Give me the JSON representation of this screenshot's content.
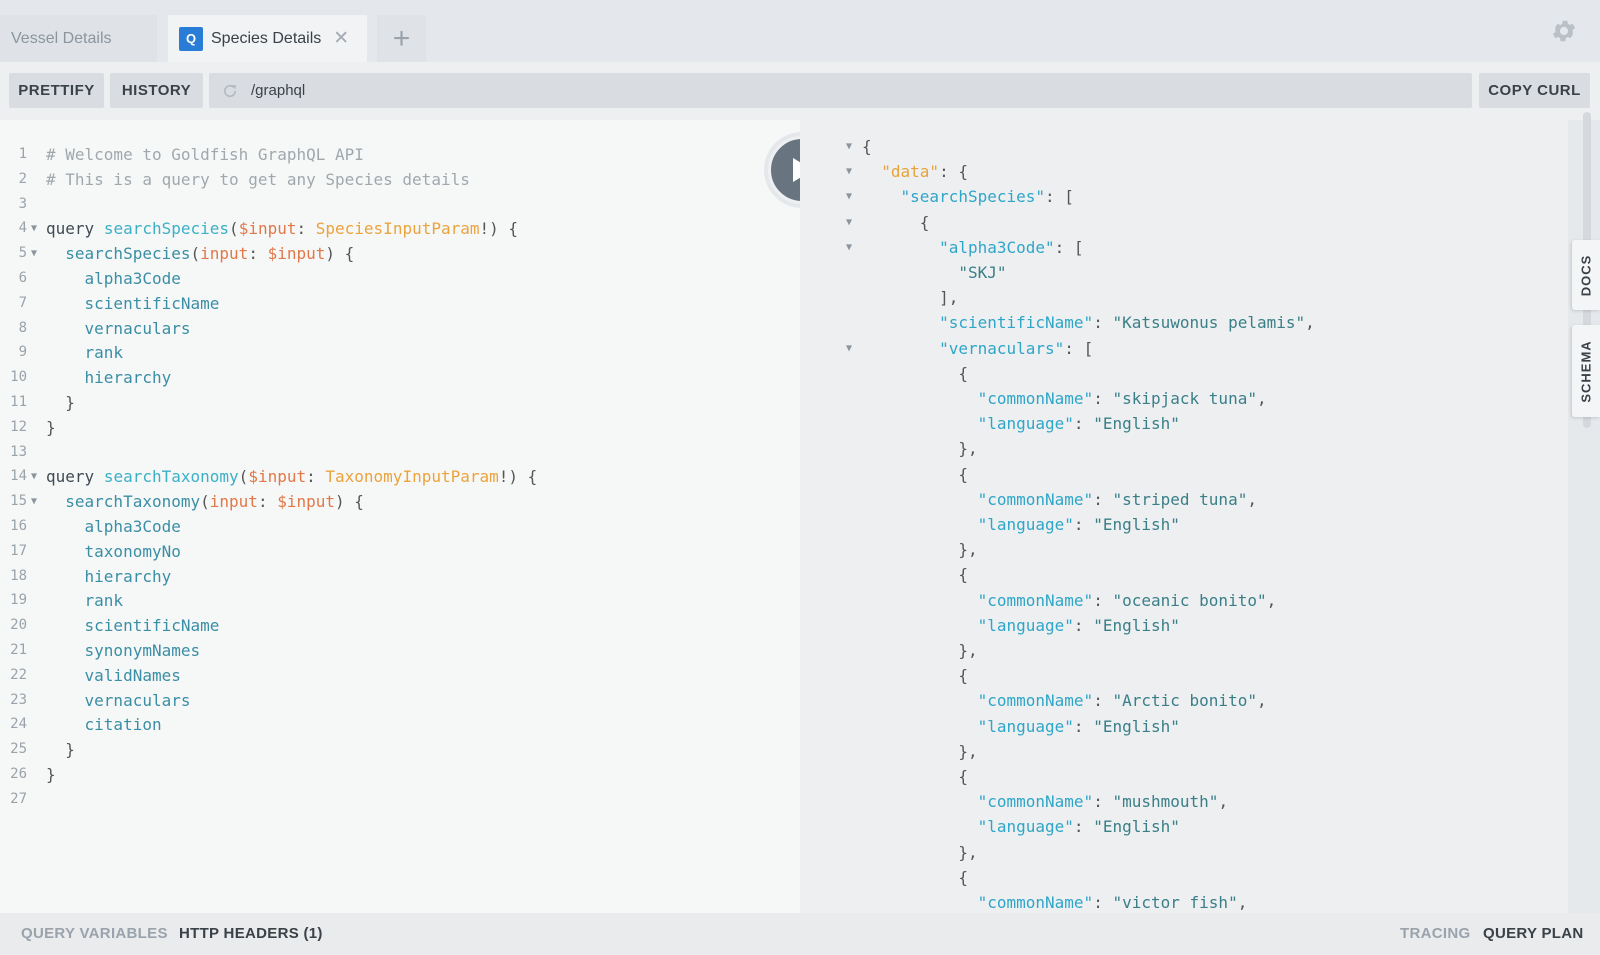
{
  "tabs": [
    {
      "label": "Vessel Details"
    },
    {
      "label": "Species Details",
      "badge": "Q"
    }
  ],
  "toolbar": {
    "prettify": "PRETTIFY",
    "history": "HISTORY",
    "url": "/graphql",
    "copy_curl": "COPY CURL"
  },
  "query_lines": [
    "# Welcome to Goldfish GraphQL API",
    "# This is a query to get any Species details",
    "",
    "query searchSpecies($input: SpeciesInputParam!) {",
    "  searchSpecies(input: $input) {",
    "    alpha3Code",
    "    scientificName",
    "    vernaculars",
    "    rank",
    "    hierarchy",
    "  }",
    "}",
    "",
    "query searchTaxonomy($input: TaxonomyInputParam!) {",
    "  searchTaxonomy(input: $input) {",
    "    alpha3Code",
    "    taxonomyNo",
    "    hierarchy",
    "    rank",
    "    scientificName",
    "    synonymNames",
    "    validNames",
    "    vernaculars",
    "    citation",
    "  }",
    "}",
    ""
  ],
  "result_lines": [
    "{",
    "  \"data\": {",
    "    \"searchSpecies\": [",
    "      {",
    "        \"alpha3Code\": [",
    "          \"SKJ\"",
    "        ],",
    "        \"scientificName\": \"Katsuwonus pelamis\",",
    "        \"vernaculars\": [",
    "          {",
    "            \"commonName\": \"skipjack tuna\",",
    "            \"language\": \"English\"",
    "          },",
    "          {",
    "            \"commonName\": \"striped tuna\",",
    "            \"language\": \"English\"",
    "          },",
    "          {",
    "            \"commonName\": \"oceanic bonito\",",
    "            \"language\": \"English\"",
    "          },",
    "          {",
    "            \"commonName\": \"Arctic bonito\",",
    "            \"language\": \"English\"",
    "          },",
    "          {",
    "            \"commonName\": \"mushmouth\",",
    "            \"language\": \"English\"",
    "          },",
    "          {",
    "            \"commonName\": \"victor fish\","
  ],
  "side_tabs": {
    "docs": "DOCS",
    "schema": "SCHEMA"
  },
  "bottom": {
    "query_variables": "QUERY VARIABLES",
    "http_headers": "HTTP HEADERS (1)",
    "tracing": "TRACING",
    "query_plan": "QUERY PLAN"
  },
  "icons": {
    "play": "play-icon",
    "gear": "gear-icon",
    "close": "close-icon",
    "add": "plus-icon",
    "refresh": "refresh-icon",
    "fold": "triangle-down-icon"
  },
  "colors": {
    "badge": "#2a7dd6",
    "play_button": "#687580",
    "comment": "#a0a8ae",
    "definition": "#3bb0c6",
    "variable": "#e07849",
    "type": "#eba33d",
    "field": "#3a8ea5",
    "json_key": "#2fa6c8",
    "json_string": "#3a7f88",
    "json_data_key": "#e7a33a"
  }
}
